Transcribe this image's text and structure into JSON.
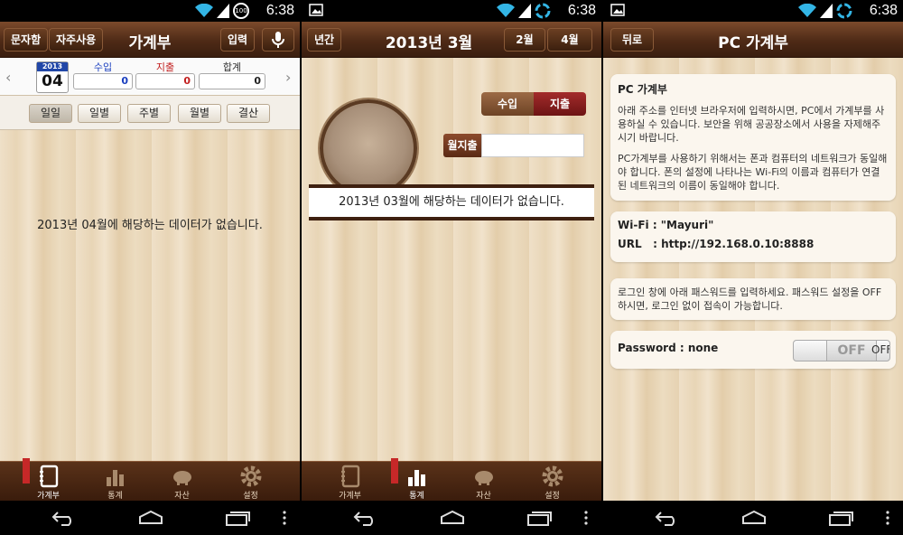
{
  "status": {
    "time": "6:38",
    "battery": "100"
  },
  "tabs": [
    "가계부",
    "통계",
    "자산",
    "설정"
  ],
  "panel1": {
    "btn_sms": "문자함",
    "btn_freq": "자주사용",
    "title": "가계부",
    "btn_input": "입력",
    "calendar_year": "2013",
    "calendar_month": "04",
    "income_label": "수입",
    "expense_label": "지출",
    "total_label": "합계",
    "income_value": "0",
    "expense_value": "0",
    "total_value": "0",
    "periods": [
      "일일",
      "일별",
      "주별",
      "월별",
      "결산"
    ],
    "no_data": "2013년 04월에 해당하는 데이터가 없습니다."
  },
  "panel2": {
    "btn_year": "년간",
    "title": "2013년 3월",
    "btn_prev": "2월",
    "btn_next": "4월",
    "seg_income": "수입",
    "seg_expense": "지출",
    "monthly_label": "월지출",
    "no_data": "2013년 03월에 해당하는 데이터가 없습니다."
  },
  "panel3": {
    "btn_back": "뒤로",
    "title": "PC 가계부",
    "card1_title": "PC 가계부",
    "card1_p1": "아래 주소를 인터넷 브라우저에 입력하시면, PC에서 가계부를 사용하실 수 있습니다. 보안을 위해 공공장소에서 사용을 자제해주시기 바랍니다.",
    "card1_p2": "PC가계부를 사용하기 위해서는 폰과 컴퓨터의 네트워크가 동일해야 합니다. 폰의 설정에 나타나는 Wi-Fi의 이름과 컴퓨터가 연결된 네트워크의 이름이 동일해야 합니다.",
    "wifi": "Wi-Fi : \"Mayuri\"",
    "url": "URL   : http://192.168.0.10:8888",
    "card3_text": "로그인 창에 아래 패스워드를 입력하세요. 패스워드 설정을 OFF 하시면, 로그인 없이 접속이 가능합니다.",
    "password": "Password : none",
    "toggle_label": "OFF",
    "toggle_state": "OFF"
  },
  "colors": {
    "accent_wood": "#4e2a16",
    "income": "#1a3fbf",
    "expense": "#c21f1f"
  }
}
